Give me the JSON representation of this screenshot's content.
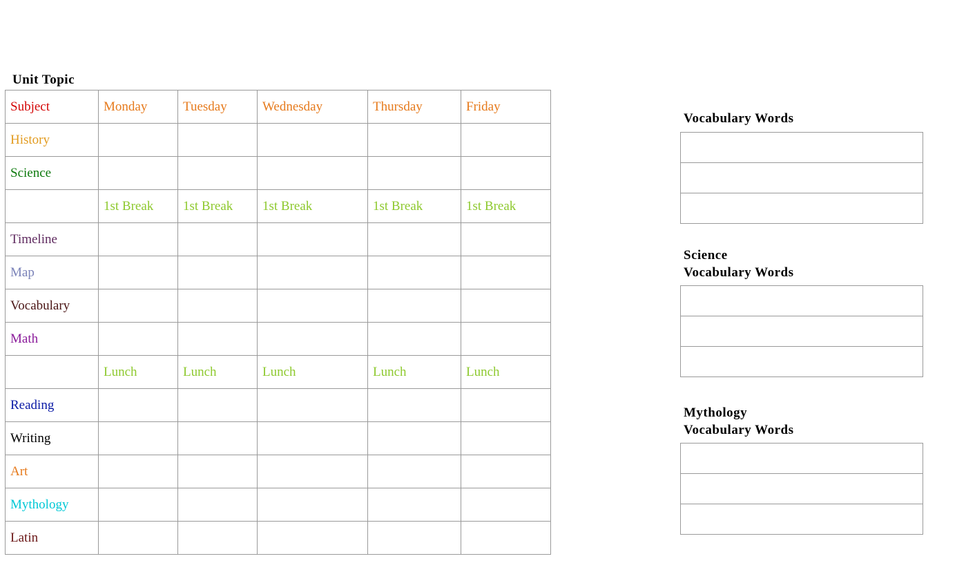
{
  "title": "Unit Topic",
  "colors": {
    "subject": "#d40606",
    "days": "#e67a1c",
    "history": "#e29b1f",
    "science": "#0e7a0e",
    "break": "#8ec92f",
    "timeline": "#5f2a5f",
    "map": "#7a82b8",
    "vocabulary": "#4a1515",
    "math": "#8a1a9a",
    "lunch": "#8ec92f",
    "reading": "#0a1aa6",
    "writing": "#000000",
    "art": "#e67a1c",
    "mythology": "#00c8d6",
    "latin": "#6a1616"
  },
  "schedule": {
    "headerRow": {
      "subject": "Subject",
      "days": [
        "Monday",
        "Tuesday",
        "Wednesday",
        "Thursday",
        "Friday"
      ]
    },
    "rows": [
      {
        "subject": "History",
        "subjectColor": "history",
        "cells": [
          "",
          "",
          "",
          "",
          ""
        ]
      },
      {
        "subject": "Science",
        "subjectColor": "science",
        "cells": [
          "",
          "",
          "",
          "",
          ""
        ]
      },
      {
        "subject": "",
        "subjectColor": "break",
        "cells": [
          "1st Break",
          "1st Break",
          "1st Break",
          "1st Break",
          "1st Break"
        ],
        "cellColor": "break"
      },
      {
        "subject": "Timeline",
        "subjectColor": "timeline",
        "cells": [
          "",
          "",
          "",
          "",
          ""
        ]
      },
      {
        "subject": "Map",
        "subjectColor": "map",
        "cells": [
          "",
          "",
          "",
          "",
          ""
        ]
      },
      {
        "subject": "Vocabulary",
        "subjectColor": "vocabulary",
        "cells": [
          "",
          "",
          "",
          "",
          ""
        ]
      },
      {
        "subject": "Math",
        "subjectColor": "math",
        "cells": [
          "",
          "",
          "",
          "",
          ""
        ]
      },
      {
        "subject": "",
        "subjectColor": "lunch",
        "cells": [
          "Lunch",
          "Lunch",
          "Lunch",
          "Lunch",
          "Lunch"
        ],
        "cellColor": "lunch"
      },
      {
        "subject": "Reading",
        "subjectColor": "reading",
        "cells": [
          "",
          "",
          "",
          "",
          ""
        ]
      },
      {
        "subject": "Writing",
        "subjectColor": "writing",
        "cells": [
          "",
          "",
          "",
          "",
          ""
        ]
      },
      {
        "subject": "Art",
        "subjectColor": "art",
        "cells": [
          "",
          "",
          "",
          "",
          ""
        ]
      },
      {
        "subject": "Mythology",
        "subjectColor": "mythology",
        "cells": [
          "",
          "",
          "",
          "",
          ""
        ]
      },
      {
        "subject": "Latin",
        "subjectColor": "latin",
        "cells": [
          "",
          "",
          "",
          "",
          ""
        ]
      }
    ]
  },
  "sidebar": [
    {
      "title": "Vocabulary Words",
      "rows": 3
    },
    {
      "title": "Science\nVocabulary Words",
      "rows": 3
    },
    {
      "title": "Mythology\nVocabulary Words",
      "rows": 3
    }
  ]
}
